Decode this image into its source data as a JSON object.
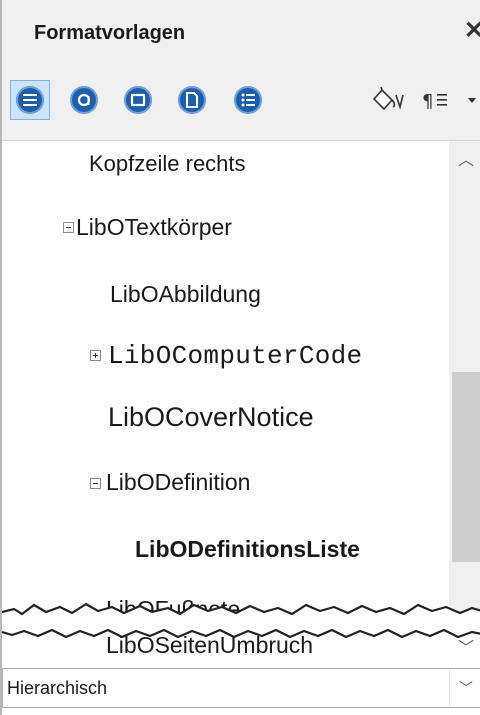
{
  "panel": {
    "title": "Formatvorlagen",
    "close_glyph": "✕"
  },
  "toolbar": {
    "buttons": [
      {
        "name": "paragraph-styles-icon",
        "selected": true
      },
      {
        "name": "character-styles-icon",
        "selected": false
      },
      {
        "name": "frame-styles-icon",
        "selected": false
      },
      {
        "name": "page-styles-icon",
        "selected": false
      },
      {
        "name": "list-styles-icon",
        "selected": false
      }
    ],
    "fill_format_icon": "paint-bucket-icon",
    "new_style_icon": "pilcrow-menu-icon"
  },
  "tree": {
    "items": [
      {
        "label": "Kopfzeile rechts",
        "expander": "none",
        "bold": false,
        "mono": false
      },
      {
        "label": "LibOTextkörper",
        "expander": "minus",
        "bold": false,
        "mono": false
      },
      {
        "label": "LibOAbbildung",
        "expander": "none",
        "bold": false,
        "mono": false
      },
      {
        "label": "LibOComputerCode",
        "expander": "plus",
        "bold": false,
        "mono": true
      },
      {
        "label": "LibOCoverNotice",
        "expander": "none",
        "bold": false,
        "mono": false
      },
      {
        "label": "LibODefinition",
        "expander": "minus",
        "bold": false,
        "mono": false
      },
      {
        "label": "LibODefinitionsListe",
        "expander": "none",
        "bold": true,
        "mono": false
      },
      {
        "label": "LibOFußnote",
        "expander": "none",
        "bold": false,
        "mono": false
      },
      {
        "label": "LibOSeitenUmbruch",
        "expander": "none",
        "bold": false,
        "mono": false
      }
    ]
  },
  "filter": {
    "selected": "Hierarchisch"
  },
  "colors": {
    "accent": "#1f5fa8",
    "selection_bg": "#cde4f7"
  }
}
